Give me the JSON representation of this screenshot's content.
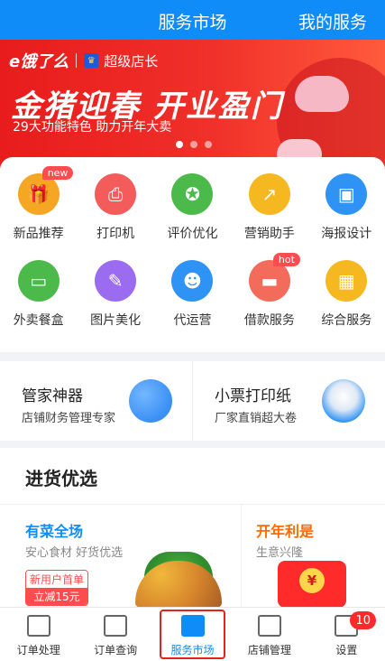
{
  "header": {
    "title": "服务市场",
    "right_link": "我的服务"
  },
  "banner": {
    "brand": "e饿了么",
    "sub_brand": "超级店长",
    "headline": "金猪迎春 开业盈门",
    "tagline": "29大功能特色 助力开年大卖",
    "carousel_count": 3,
    "carousel_active_index": 0
  },
  "grid": [
    {
      "label": "新品推荐",
      "icon": "gift-icon",
      "color": "#f5a623",
      "badge": "new"
    },
    {
      "label": "打印机",
      "icon": "printer-icon",
      "color": "#f45b5b",
      "badge": ""
    },
    {
      "label": "评价优化",
      "icon": "medal-icon",
      "color": "#4cba4a",
      "badge": ""
    },
    {
      "label": "营销助手",
      "icon": "chart-icon",
      "color": "#f5b820",
      "badge": ""
    },
    {
      "label": "海报设计",
      "icon": "image-icon",
      "color": "#2f93f5",
      "badge": ""
    },
    {
      "label": "外卖餐盒",
      "icon": "box-icon",
      "color": "#4cba4a",
      "badge": ""
    },
    {
      "label": "图片美化",
      "icon": "brush-icon",
      "color": "#9b6cf0",
      "badge": ""
    },
    {
      "label": "代运营",
      "icon": "robot-icon",
      "color": "#2f93f5",
      "badge": ""
    },
    {
      "label": "借款服务",
      "icon": "card-icon",
      "color": "#f26b5b",
      "badge": "hot"
    },
    {
      "label": "综合服务",
      "icon": "apps-icon",
      "color": "#f5b820",
      "badge": ""
    }
  ],
  "promos": [
    {
      "title": "管家神器",
      "subtitle": "店铺财务管理专家",
      "icon": "ledger-icon",
      "color": "#3a8ff5"
    },
    {
      "title": "小票打印纸",
      "subtitle": "厂家直销超大卷",
      "icon": "paper-roll-icon",
      "color": "#2f93f5"
    }
  ],
  "section": {
    "title": "进货优选",
    "left": {
      "title": "有菜全场",
      "subtitle": "安心食材 好货优选",
      "tag_top": "新用户首单",
      "tag_bottom": "立减15元",
      "color": "#0f8cf7"
    },
    "right": {
      "title": "开年利是",
      "subtitle": "生意兴隆",
      "coin": "¥",
      "color": "#ff6a00"
    }
  },
  "tabbar": [
    {
      "label": "订单处理",
      "icon": "document-icon",
      "active": false,
      "badge": ""
    },
    {
      "label": "订单查询",
      "icon": "list-icon",
      "active": false,
      "badge": ""
    },
    {
      "label": "服务市场",
      "icon": "bag-icon",
      "active": true,
      "badge": ""
    },
    {
      "label": "店铺管理",
      "icon": "store-icon",
      "active": false,
      "badge": ""
    },
    {
      "label": "设置",
      "icon": "settings-icon",
      "active": false,
      "badge": "10"
    }
  ]
}
